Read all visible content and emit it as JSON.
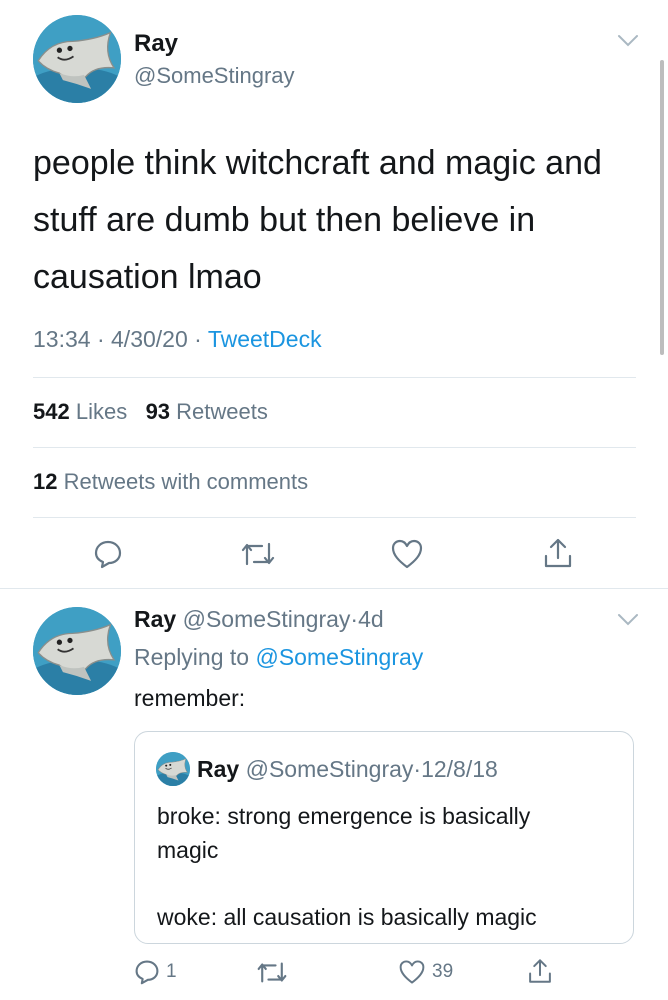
{
  "main_tweet": {
    "display_name": "Ray",
    "handle": "@SomeStingray",
    "text_lines": [
      "people think witchcraft and magic and",
      "stuff are dumb but then believe in",
      "causation lmao"
    ],
    "time": "13:34",
    "date": "4/30/20",
    "source": "TweetDeck",
    "sep": "·",
    "likes_count": "542",
    "likes_label": "Likes",
    "retweets_count": "93",
    "retweets_label": "Retweets",
    "quote_count": "12",
    "quote_label": "Retweets with comments"
  },
  "reply": {
    "display_name": "Ray",
    "handle": "@SomeStingray",
    "sep": "·",
    "age": "4d",
    "replying_prefix": "Replying to",
    "replying_handle": "@SomeStingray",
    "text": "remember:",
    "quoted": {
      "display_name": "Ray",
      "handle": "@SomeStingray",
      "sep": "·",
      "date": "12/8/18",
      "line1": "broke: strong emergence is basically",
      "line2": "magic",
      "line3": "woke: all causation is basically magic"
    },
    "reply_count": "1",
    "like_count": "39"
  },
  "icons": {
    "caret": "chevron-down-icon",
    "reply": "reply-bubble-icon",
    "retweet": "retweet-icon",
    "like": "heart-icon",
    "share": "share-icon"
  },
  "colors": {
    "link": "#1b95e0",
    "secondary": "#657786",
    "divider": "#e1e8ed"
  }
}
